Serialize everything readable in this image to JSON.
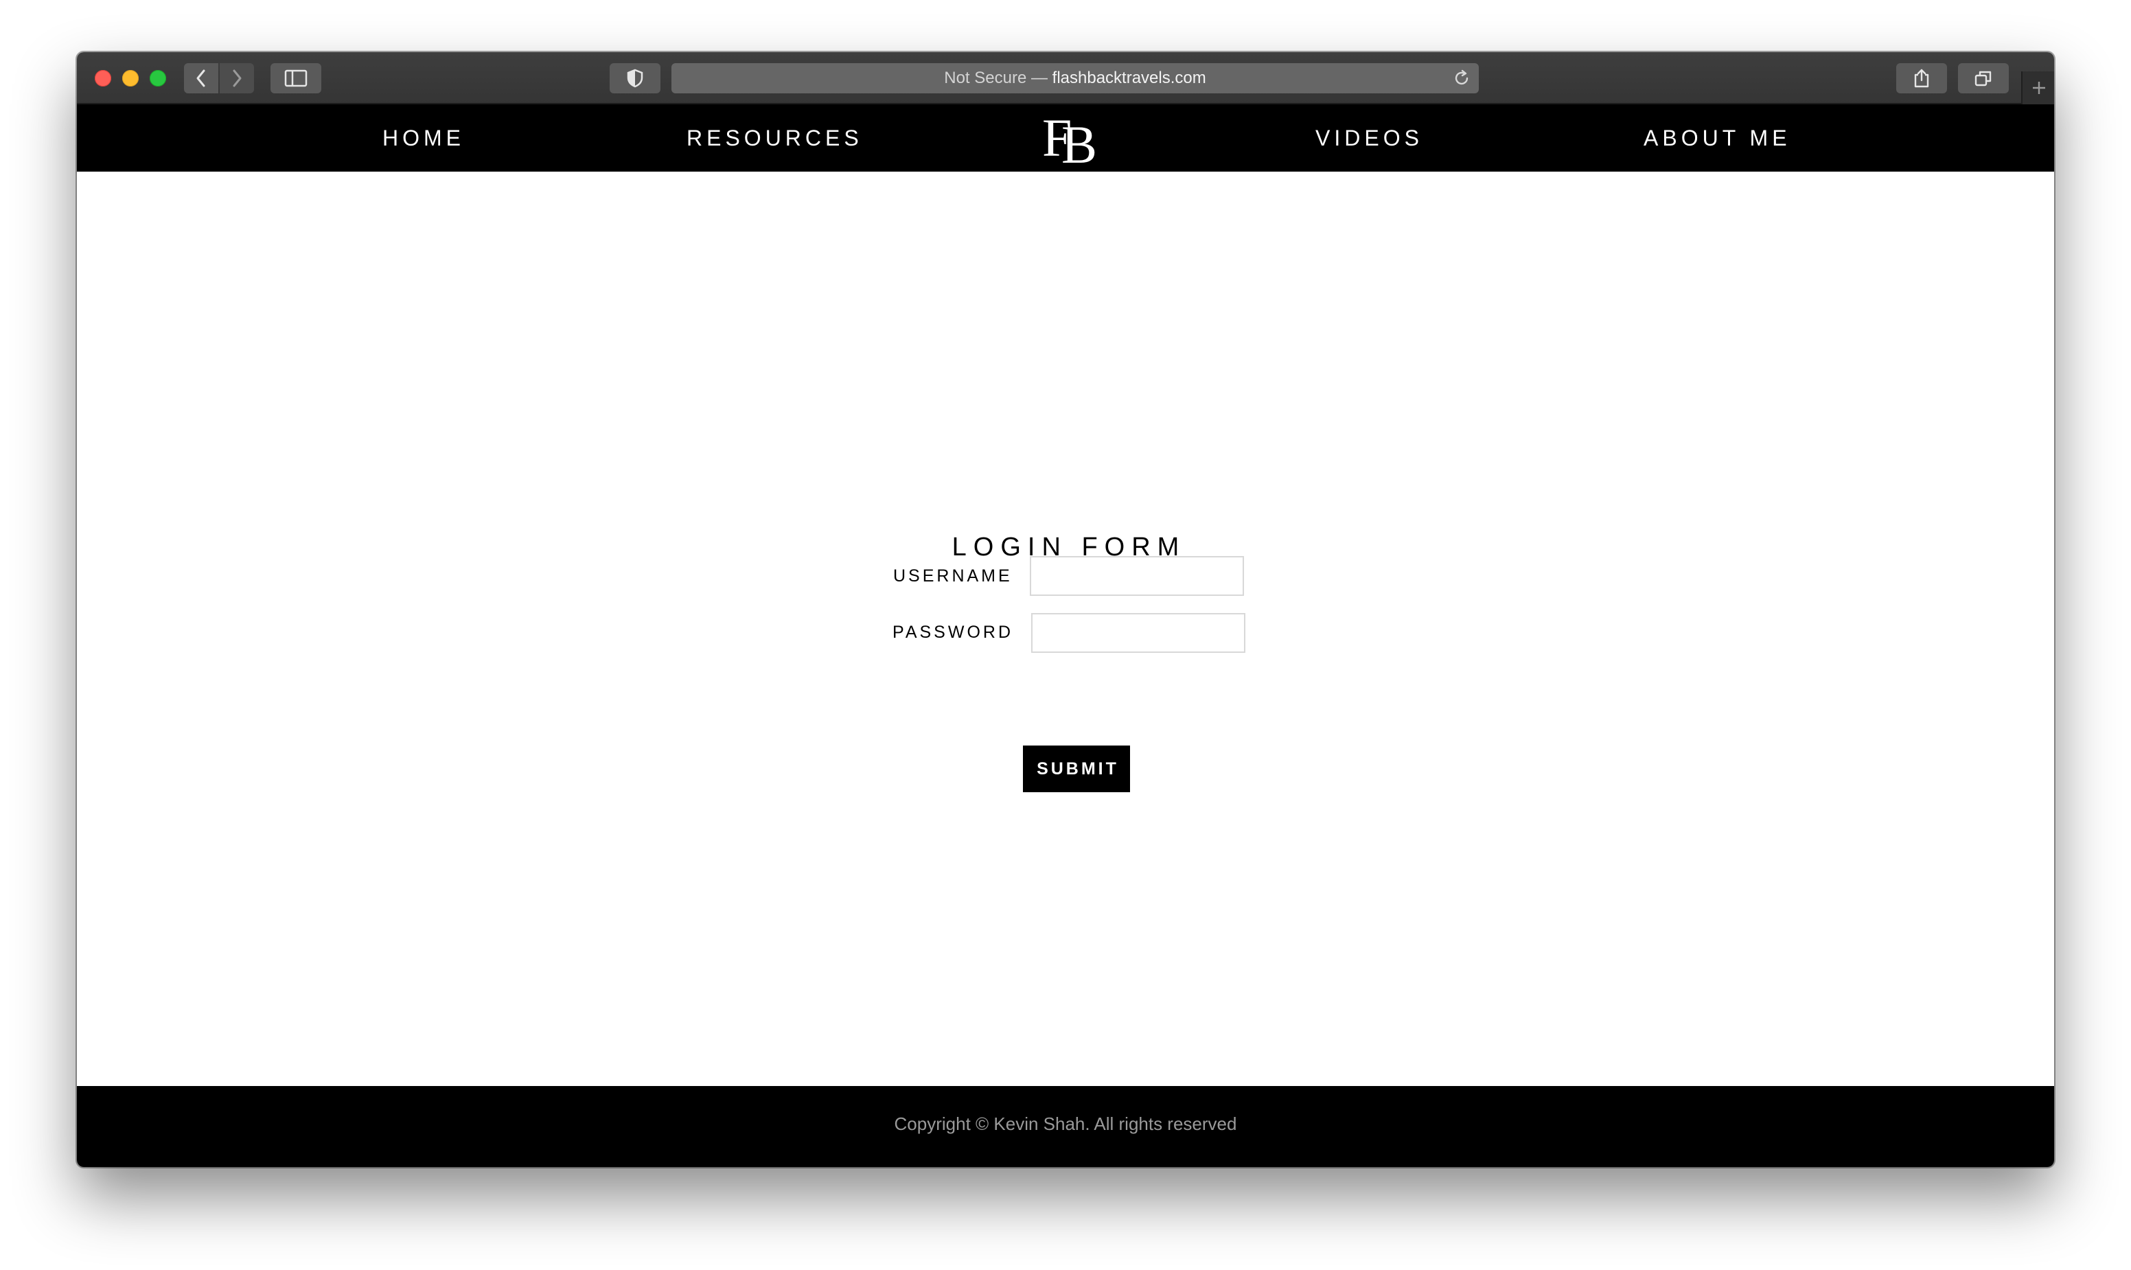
{
  "browser": {
    "address": {
      "security_label": "Not Secure — ",
      "domain": "flashbacktravels.com"
    },
    "icons": {
      "back": "chevron-left-icon",
      "forward": "chevron-right-icon",
      "sidebar": "sidebar-icon",
      "privacy": "shield-icon",
      "reload": "reload-icon",
      "share": "share-icon",
      "tabs": "tab-overview-icon",
      "new_tab": "plus-icon"
    }
  },
  "nav": {
    "items": [
      {
        "label": "HOME"
      },
      {
        "label": "RESOURCES"
      },
      {
        "label": "VIDEOS"
      },
      {
        "label": "ABOUT ME"
      }
    ],
    "logo": {
      "text": "FB",
      "f": "F",
      "b": "B"
    }
  },
  "login": {
    "title": "LOGIN FORM",
    "username_label": "USERNAME",
    "username_value": "",
    "password_label": "PASSWORD",
    "password_value": "",
    "submit_label": "SUBMIT"
  },
  "footer": {
    "text": "Copyright © Kevin Shah. All rights reserved"
  },
  "colors": {
    "nav_background": "#000000",
    "nav_text": "#ffffff",
    "footer_text": "#9a9a9a",
    "toolbar": "#3b3b3b"
  }
}
